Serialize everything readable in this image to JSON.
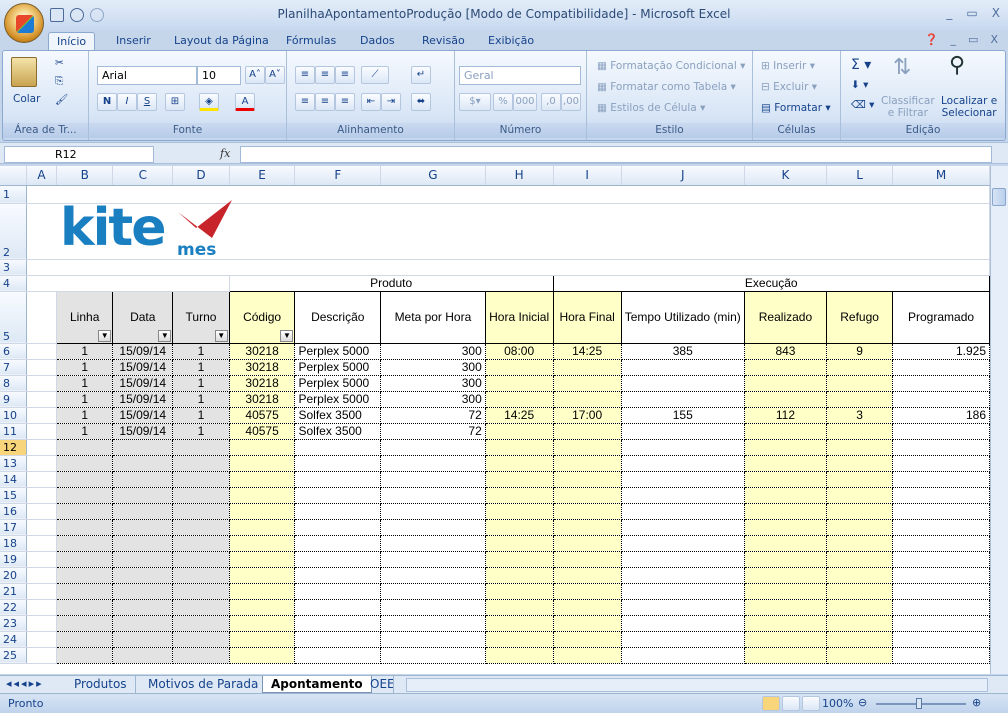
{
  "window": {
    "title": "PlanilhaApontamentoProdução  [Modo de Compatibilidade] - Microsoft Excel",
    "min": "_",
    "max": "▭",
    "close": "X"
  },
  "tabs": [
    "Início",
    "Inserir",
    "Layout da Página",
    "Fórmulas",
    "Dados",
    "Revisão",
    "Exibição"
  ],
  "ribbon": {
    "clipboard": {
      "label": "Área de Tr...",
      "paste": "Colar"
    },
    "font": {
      "label": "Fonte",
      "name": "Arial",
      "size": "10"
    },
    "alignment": {
      "label": "Alinhamento"
    },
    "number": {
      "label": "Número",
      "format": "Geral"
    },
    "styles": {
      "label": "Estilo",
      "cond": "Formatação Condicional",
      "table": "Formatar como Tabela",
      "cell": "Estilos de Célula"
    },
    "cells": {
      "label": "Células",
      "insert": "Inserir",
      "delete": "Excluir",
      "format": "Formatar"
    },
    "editing": {
      "label": "Edição",
      "sort": "Classificar",
      "sort2": "e Filtrar",
      "find": "Localizar e",
      "find2": "Selecionar"
    }
  },
  "formula_bar": {
    "namebox": "R12",
    "fx": "fx",
    "content": ""
  },
  "columns": [
    "A",
    "B",
    "C",
    "D",
    "E",
    "F",
    "G",
    "H",
    "I",
    "J",
    "K",
    "L",
    "M"
  ],
  "logo": {
    "brand": "kite",
    "sub": "mes"
  },
  "group_headers": {
    "produto": "Produto",
    "execucao": "Execução"
  },
  "headers": [
    "Linha",
    "Data",
    "Turno",
    "Código",
    "Descrição",
    "Meta por Hora",
    "Hora Inicial",
    "Hora Final",
    "Tempo Utilizado (min)",
    "Realizado",
    "Refugo",
    "Programado"
  ],
  "rows": [
    [
      "1",
      "15/09/14",
      "1",
      "30218",
      "Perplex 5000",
      "300",
      "08:00",
      "14:25",
      "385",
      "843",
      "9",
      "1.925"
    ],
    [
      "1",
      "15/09/14",
      "1",
      "30218",
      "Perplex 5000",
      "300",
      "",
      "",
      "",
      "",
      "",
      ""
    ],
    [
      "1",
      "15/09/14",
      "1",
      "30218",
      "Perplex 5000",
      "300",
      "",
      "",
      "",
      "",
      "",
      ""
    ],
    [
      "1",
      "15/09/14",
      "1",
      "30218",
      "Perplex 5000",
      "300",
      "",
      "",
      "",
      "",
      "",
      ""
    ],
    [
      "1",
      "15/09/14",
      "1",
      "40575",
      "Solfex 3500",
      "72",
      "14:25",
      "17:00",
      "155",
      "112",
      "3",
      "186"
    ],
    [
      "1",
      "15/09/14",
      "1",
      "40575",
      "Solfex 3500",
      "72",
      "",
      "",
      "",
      "",
      "",
      ""
    ]
  ],
  "sheet_tabs": [
    "Produtos",
    "Motivos de Parada",
    "Apontamento",
    "OEE"
  ],
  "status": {
    "text": "Pronto",
    "zoom": "100%"
  }
}
